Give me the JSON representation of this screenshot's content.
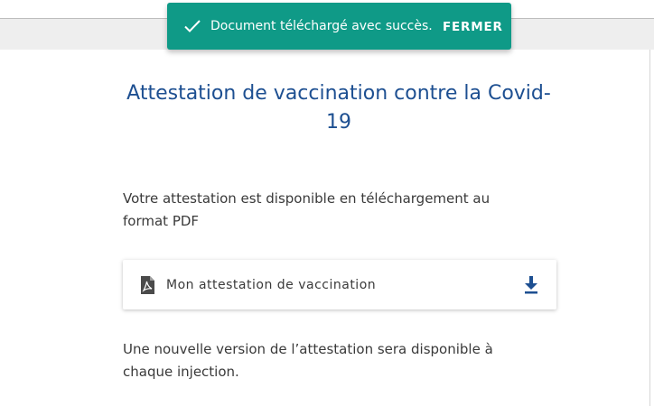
{
  "snackbar": {
    "icon": "check-icon",
    "message": "Document téléchargé avec succès.",
    "close_label": "FERMER",
    "background": "#0f9a87"
  },
  "main": {
    "title_line1": "Attestation de vaccination contre la Covid-",
    "title_line2": "19",
    "intro_line1": "Votre attestation est disponible en téléchargement au",
    "intro_line2": "format PDF",
    "download_card": {
      "icon": "pdf-file-icon",
      "label": "Mon attestation de vaccination",
      "action_icon": "download-icon"
    },
    "note_line1": "Une nouvelle version de l’attestation sera disponible à",
    "note_line2": "chaque injection."
  },
  "colors": {
    "title": "#1d4f91",
    "download_icon": "#1d4f91",
    "text": "#3a3a3a"
  }
}
